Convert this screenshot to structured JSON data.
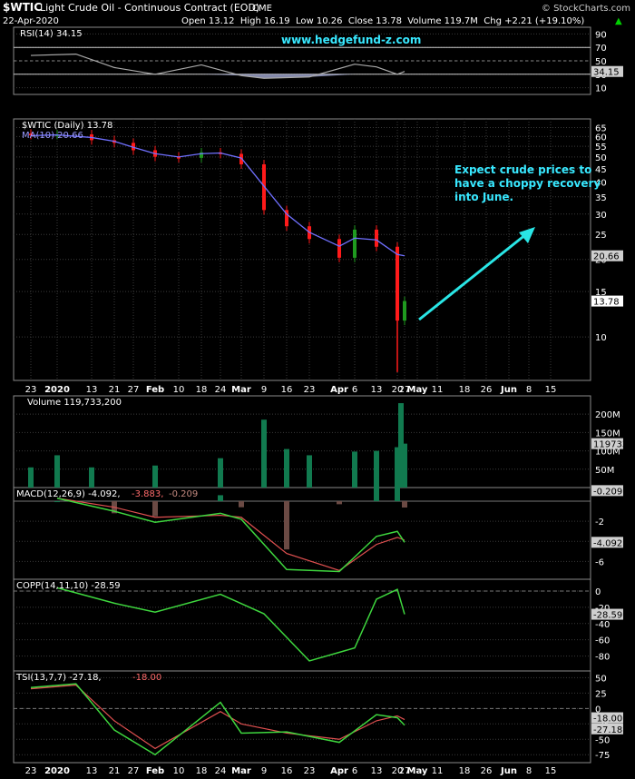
{
  "header": {
    "symbol": "$WTIC",
    "name": "Light Crude Oil - Continuous Contract (EOD)",
    "exchange": "CME",
    "watermark": "© StockCharts.com",
    "date": "22-Apr-2020",
    "ohlc": "Open 13.12  High 16.19  Low 10.26  Close 13.78  Volume 119.7M  Chg +2.21 (+19.10%)",
    "change_arrow": "▲"
  },
  "site": "www.hedgefund-z.com",
  "annotation": [
    "Expect crude prices to",
    "have a choppy recovery",
    "into June."
  ],
  "colors": {
    "up": "#1f9a1f",
    "down": "#ff1a1a",
    "volume": "#117a4f",
    "ma": "#7070ff",
    "arrow": "#29e6e6",
    "rsi_fill": "#9aa0c8",
    "macd_hist": "#6b4a44",
    "text_cyan": "#38e8ff",
    "green_line": "#3ed63e",
    "red_line": "#e05050",
    "tag": "#cfcfcf"
  },
  "xaxis": {
    "labels": [
      "23",
      "2020",
      "13",
      "21",
      "27",
      "Feb",
      "10",
      "18",
      "24",
      "Mar",
      "9",
      "16",
      "23",
      "Apr",
      "6",
      "13",
      "20",
      "27",
      "May",
      "11",
      "18",
      "26",
      "Jun",
      "8",
      "15"
    ],
    "bold": [
      "2020",
      "Feb",
      "Mar",
      "Apr",
      "May",
      "Jun"
    ]
  },
  "panels": {
    "rsi": {
      "label": "RSI(14) 34.15",
      "value_tag": "34.15",
      "ticks": [
        "90",
        "70",
        "50",
        "30",
        "10"
      ]
    },
    "price": {
      "label": "$WTIC (Daily) 13.78",
      "ma_label": "MA(10) 20.66",
      "ma_tag": "20.66",
      "close_tag": "13.78",
      "ticks": [
        "65",
        "60",
        "55",
        "50",
        "45",
        "40",
        "35",
        "30",
        "25",
        "20",
        "15",
        "10"
      ]
    },
    "volume": {
      "label": "Volume 119,733,200",
      "value_tag": "119733200",
      "ticks": [
        "200M",
        "150M",
        "100M",
        "50M"
      ]
    },
    "macd": {
      "label_main": "MACD(12,26,9) -4.092,",
      "label_signal": "-3.883,",
      "label_hist": "-0.209",
      "tag_hist": "-0.209",
      "tag_macd": "-4.092",
      "ticks": [
        "-2",
        "-4",
        "-6"
      ]
    },
    "copp": {
      "label": "COPP(14,11,10) -28.59",
      "value_tag": "-28.59",
      "ticks": [
        "0",
        "-20",
        "-40",
        "-60",
        "-80"
      ]
    },
    "tsi": {
      "label_main": "TSI(13,7,7) -27.18,",
      "label_signal": "-18.00",
      "tag_signal": "-18.00",
      "tag_main": "-27.18",
      "ticks": [
        "50",
        "25",
        "0",
        "-25",
        "-50",
        "-75"
      ]
    }
  },
  "chart_data": [
    {
      "type": "candlestick",
      "title": "$WTIC (Daily) 13.78",
      "x": [
        "2019-12-23",
        "2020-01-02",
        "2020-01-13",
        "2020-01-21",
        "2020-01-27",
        "2020-02-03",
        "2020-02-10",
        "2020-02-18",
        "2020-02-24",
        "2020-03-02",
        "2020-03-09",
        "2020-03-16",
        "2020-03-23",
        "2020-04-01",
        "2020-04-06",
        "2020-04-13",
        "2020-04-20",
        "2020-04-22"
      ],
      "close": [
        61.0,
        61.2,
        58.1,
        56.7,
        53.1,
        50.1,
        49.6,
        52.1,
        51.4,
        46.8,
        31.1,
        26.9,
        24.0,
        20.3,
        26.1,
        22.4,
        11.57,
        13.78
      ],
      "ma10": [
        60.5,
        60.9,
        59.5,
        57.5,
        54.5,
        51.5,
        50.0,
        51.5,
        51.8,
        49.5,
        38.5,
        30.0,
        25.5,
        22.5,
        24.2,
        23.8,
        20.9,
        20.66
      ],
      "ylim": [
        7,
        68
      ],
      "yscale": "log",
      "series": [
        {
          "name": "$WTIC"
        },
        {
          "name": "MA(10)"
        }
      ]
    },
    {
      "type": "line",
      "title": "RSI(14) 34.15",
      "x": [
        "2019-12-23",
        "2020-01-08",
        "2020-01-21",
        "2020-02-03",
        "2020-02-18",
        "2020-03-02",
        "2020-03-09",
        "2020-03-23",
        "2020-04-06",
        "2020-04-13",
        "2020-04-20",
        "2020-04-22"
      ],
      "values": [
        58,
        60,
        40,
        30,
        44,
        28,
        24,
        26,
        45,
        41,
        30,
        34.15
      ],
      "ylim": [
        0,
        100
      ]
    },
    {
      "type": "bar",
      "title": "Volume 119,733,200",
      "x": [
        "2019-12-23",
        "2020-01-02",
        "2020-01-13",
        "2020-02-03",
        "2020-02-24",
        "2020-03-09",
        "2020-03-16",
        "2020-03-23",
        "2020-04-06",
        "2020-04-13",
        "2020-04-20",
        "2020-04-21",
        "2020-04-22"
      ],
      "values": [
        55,
        88,
        55,
        60,
        80,
        185,
        105,
        88,
        98,
        100,
        110,
        230,
        119.7
      ],
      "unit": "M",
      "ylim": [
        0,
        240
      ]
    },
    {
      "type": "line",
      "title": "MACD(12,26,9) -4.092, -3.883, -0.209",
      "x": [
        "2020-01-02",
        "2020-01-21",
        "2020-02-03",
        "2020-02-24",
        "2020-03-02",
        "2020-03-16",
        "2020-04-01",
        "2020-04-13",
        "2020-04-20",
        "2020-04-22"
      ],
      "series": [
        {
          "name": "MACD",
          "values": [
            0.3,
            -1.0,
            -2.1,
            -1.2,
            -1.8,
            -6.8,
            -7.0,
            -3.5,
            -3.0,
            -4.092
          ]
        },
        {
          "name": "Signal",
          "values": [
            0.3,
            -0.6,
            -1.6,
            -1.4,
            -1.6,
            -5.2,
            -6.9,
            -4.3,
            -3.6,
            -3.883
          ]
        },
        {
          "name": "Histogram",
          "values": [
            0,
            -0.4,
            -0.5,
            0.2,
            -0.2,
            -1.6,
            -0.1,
            0.8,
            0.6,
            -0.209
          ]
        }
      ],
      "ylim": [
        -7.5,
        1
      ]
    },
    {
      "type": "line",
      "title": "COPP(14,11,10) -28.59",
      "x": [
        "2020-01-02",
        "2020-01-21",
        "2020-02-03",
        "2020-02-24",
        "2020-03-09",
        "2020-03-23",
        "2020-04-06",
        "2020-04-13",
        "2020-04-20",
        "2020-04-22"
      ],
      "values": [
        4,
        -15,
        -26,
        -4,
        -28,
        -86,
        -70,
        -10,
        2,
        -28.59
      ],
      "ylim": [
        -95,
        10
      ]
    },
    {
      "type": "line",
      "title": "TSI(13,7,7) -27.18, -18.00",
      "x": [
        "2019-12-23",
        "2020-01-08",
        "2020-01-21",
        "2020-02-03",
        "2020-02-24",
        "2020-03-02",
        "2020-03-16",
        "2020-04-01",
        "2020-04-13",
        "2020-04-20",
        "2020-04-22"
      ],
      "series": [
        {
          "name": "TSI",
          "values": [
            34,
            40,
            -35,
            -75,
            10,
            -40,
            -38,
            -55,
            -10,
            -15,
            -27.18
          ]
        },
        {
          "name": "Signal",
          "values": [
            32,
            38,
            -20,
            -65,
            -5,
            -25,
            -40,
            -50,
            -20,
            -12,
            -18.0
          ]
        }
      ],
      "ylim": [
        -85,
        55
      ]
    }
  ]
}
